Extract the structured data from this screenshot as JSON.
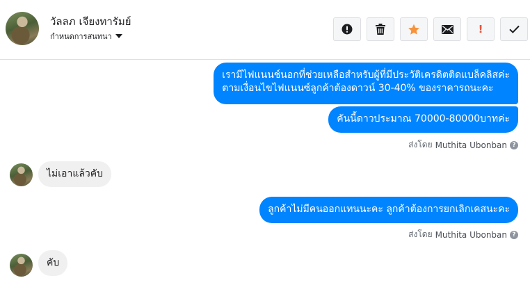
{
  "header": {
    "contact_name": "วัลลภ เจียงทารัมย์",
    "subtitle": "กำหนดการสนทนา",
    "toolbar": [
      {
        "name": "report-button",
        "icon": "alert-circle-icon",
        "color": "#1c1e21"
      },
      {
        "name": "delete-button",
        "icon": "trash-icon",
        "color": "#1c1e21"
      },
      {
        "name": "star-button",
        "icon": "star-icon",
        "color": "#f7923b"
      },
      {
        "name": "mark-unread-button",
        "icon": "envelope-icon",
        "color": "#1c1e21"
      },
      {
        "name": "important-button",
        "icon": "exclamation-icon",
        "label": "!",
        "color": "#e9543d"
      },
      {
        "name": "done-button",
        "icon": "check-icon",
        "color": "#1c1e21"
      }
    ]
  },
  "messages": {
    "out_1": {
      "line_1": "เรามีไฟแนนช์นอกที่ช่วยเหลือสำหรับผู้ที่มีประวัติเครดิตติดแบล็คลิสค่ะ",
      "line_2": "ตามเงื่อนไขไฟแนนซ์ลูกค้าต้องดาวน์ 30-40% ของราคารถนะคะ"
    },
    "out_2": "คันนี้ดาวประมาณ 70000-80000บาทค่ะ",
    "sent_by_1": {
      "prefix": "ส่งโดย",
      "sender": "Muthita Ubonban"
    },
    "in_1": "ไม่เอาแล้วคับ",
    "out_3": "ลูกค้าไม่มีคนออกแทนนะคะ ลูกค้าต้องการยกเลิกเคสนะคะ",
    "sent_by_2": {
      "prefix": "ส่งโดย",
      "sender": "Muthita Ubonban"
    },
    "in_2": "คับ"
  },
  "colors": {
    "outgoing_bubble": "#0084ff",
    "incoming_bubble": "#f1f0f0",
    "star": "#f7923b",
    "important": "#e9543d"
  }
}
